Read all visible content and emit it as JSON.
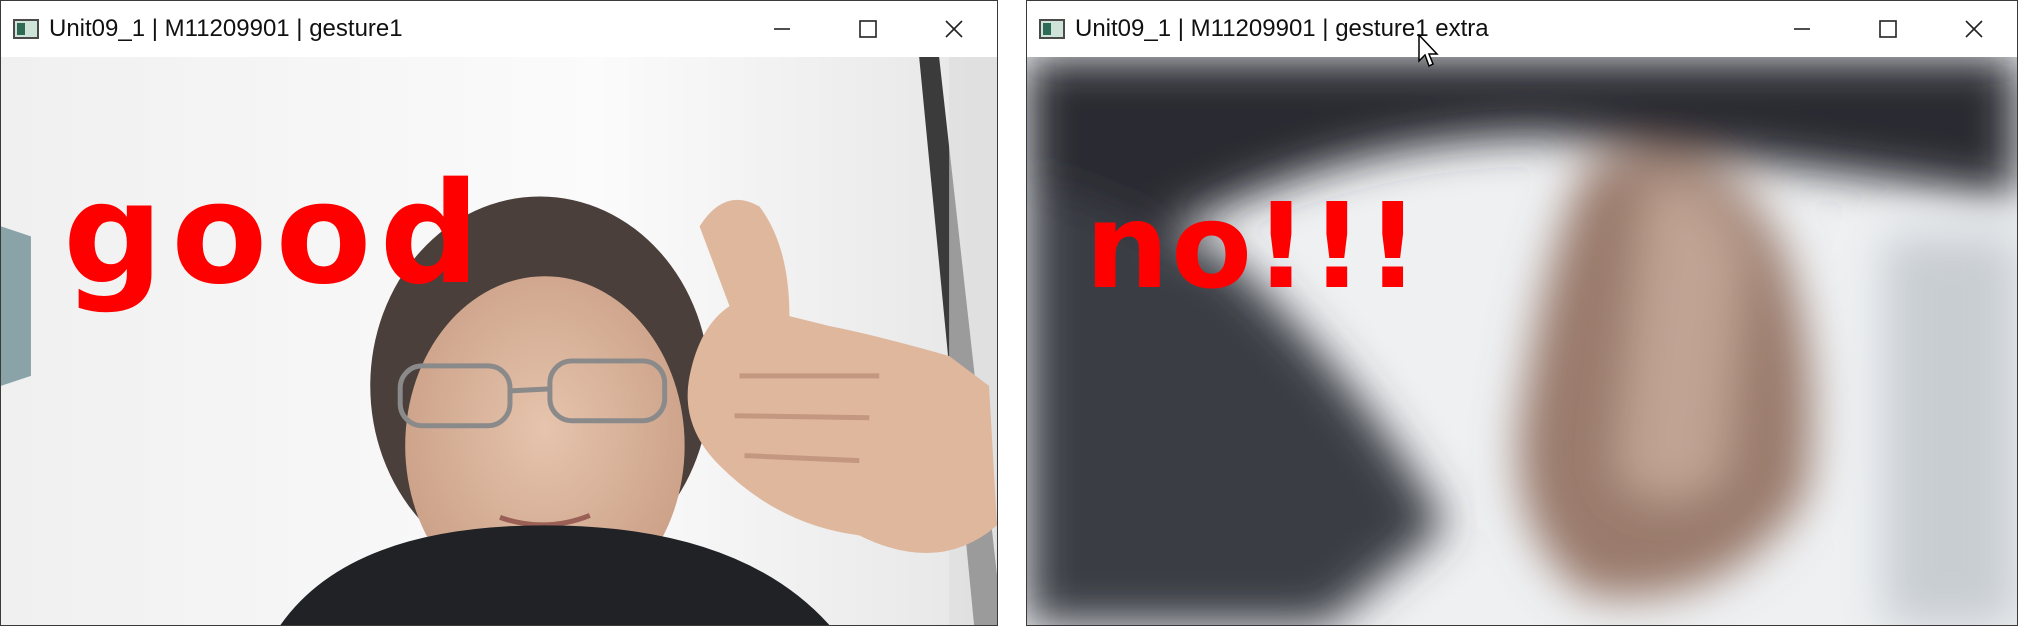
{
  "windows": [
    {
      "title": "Unit09_1 | M11209901 | gesture1",
      "gesture_text": "good",
      "controls": [
        "minimize-icon",
        "maximize-icon",
        "close-icon"
      ]
    },
    {
      "title": "Unit09_1 | M11209901 | gesture1 extra",
      "gesture_text": "no!!!",
      "controls": [
        "minimize-icon",
        "maximize-icon",
        "close-icon"
      ]
    }
  ],
  "colors": {
    "overlay_text": "#ff0000",
    "titlebar_bg": "#ffffff",
    "window_border": "#3a3a3a"
  }
}
